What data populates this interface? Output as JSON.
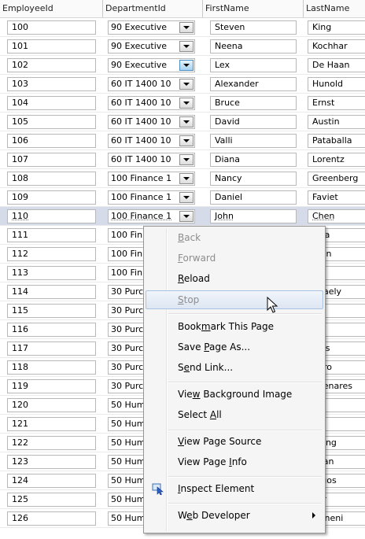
{
  "columns": [
    "EmployeeId",
    "DepartmentId",
    "FirstName",
    "LastName"
  ],
  "rows": [
    {
      "id": "100",
      "dept": "90 Executive",
      "first": "Steven",
      "last": "King"
    },
    {
      "id": "101",
      "dept": "90 Executive",
      "first": "Neena",
      "last": "Kochhar"
    },
    {
      "id": "102",
      "dept": "90 Executive",
      "first": "Lex",
      "last": "De Haan"
    },
    {
      "id": "103",
      "dept": "60 IT 1400 10",
      "first": "Alexander",
      "last": "Hunold"
    },
    {
      "id": "104",
      "dept": "60 IT 1400 10",
      "first": "Bruce",
      "last": "Ernst"
    },
    {
      "id": "105",
      "dept": "60 IT 1400 10",
      "first": "David",
      "last": "Austin"
    },
    {
      "id": "106",
      "dept": "60 IT 1400 10",
      "first": "Valli",
      "last": "Pataballa"
    },
    {
      "id": "107",
      "dept": "60 IT 1400 10",
      "first": "Diana",
      "last": "Lorentz"
    },
    {
      "id": "108",
      "dept": "100 Finance 1",
      "first": "Nancy",
      "last": "Greenberg"
    },
    {
      "id": "109",
      "dept": "100 Finance 1",
      "first": "Daniel",
      "last": "Faviet"
    },
    {
      "id": "110",
      "dept": "100 Finance 1",
      "first": "John",
      "last": "Chen"
    },
    {
      "id": "111",
      "dept": "100 Fin",
      "first": "",
      "last": "arra"
    },
    {
      "id": "112",
      "dept": "100 Fin",
      "first": "",
      "last": "man"
    },
    {
      "id": "113",
      "dept": "100 Fin",
      "first": "",
      "last": "pp"
    },
    {
      "id": "114",
      "dept": "30 Purc",
      "first": "",
      "last": "phaely"
    },
    {
      "id": "115",
      "dept": "30 Purc",
      "first": "",
      "last": "po"
    },
    {
      "id": "116",
      "dept": "30 Purc",
      "first": "",
      "last": "da"
    },
    {
      "id": "117",
      "dept": "30 Purc",
      "first": "",
      "last": "bias"
    },
    {
      "id": "118",
      "dept": "30 Purc",
      "first": "",
      "last": "huro"
    },
    {
      "id": "119",
      "dept": "30 Purc",
      "first": "",
      "last": "lmenares"
    },
    {
      "id": "120",
      "dept": "50 Hum",
      "first": "",
      "last": "iss"
    },
    {
      "id": "121",
      "dept": "50 Hum",
      "first": "",
      "last": "pp"
    },
    {
      "id": "122",
      "dept": "50 Hum",
      "first": "",
      "last": "ufling"
    },
    {
      "id": "123",
      "dept": "50 Hum",
      "first": "",
      "last": "lman"
    },
    {
      "id": "124",
      "dept": "50 Hum",
      "first": "",
      "last": "urgos"
    },
    {
      "id": "125",
      "dept": "50 Hum",
      "first": "",
      "last": "yer"
    },
    {
      "id": "126",
      "dept": "50 Hum",
      "first": "",
      "last": "kilineni"
    }
  ],
  "selected_row": "110",
  "context_menu": {
    "back": {
      "pre": "",
      "key": "B",
      "post": "ack"
    },
    "forward": {
      "pre": "",
      "key": "F",
      "post": "orward"
    },
    "reload": {
      "pre": "",
      "key": "R",
      "post": "eload"
    },
    "stop": {
      "pre": "",
      "key": "S",
      "post": "top"
    },
    "bookmark": {
      "pre": "Book",
      "key": "m",
      "post": "ark This Page"
    },
    "save_page": {
      "pre": "Save ",
      "key": "P",
      "post": "age As..."
    },
    "send_link": {
      "pre": "S",
      "key": "e",
      "post": "nd Link..."
    },
    "view_bg": {
      "pre": "Vie",
      "key": "w",
      "post": " Background Image"
    },
    "select_all": {
      "pre": "Select ",
      "key": "A",
      "post": "ll"
    },
    "view_source": {
      "pre": "",
      "key": "V",
      "post": "iew Page Source"
    },
    "view_info": {
      "pre": "View Page ",
      "key": "I",
      "post": "nfo"
    },
    "inspect": {
      "pre": "",
      "key": "I",
      "post": "nspect Element"
    },
    "web_dev": {
      "pre": "W",
      "key": "e",
      "post": "b Developer"
    }
  },
  "colors": {
    "selection": "#d6dbe9",
    "menu_bg": "#f5f5f5",
    "hover_border": "#a8c3e2",
    "disabled": "#8d8d8d"
  }
}
